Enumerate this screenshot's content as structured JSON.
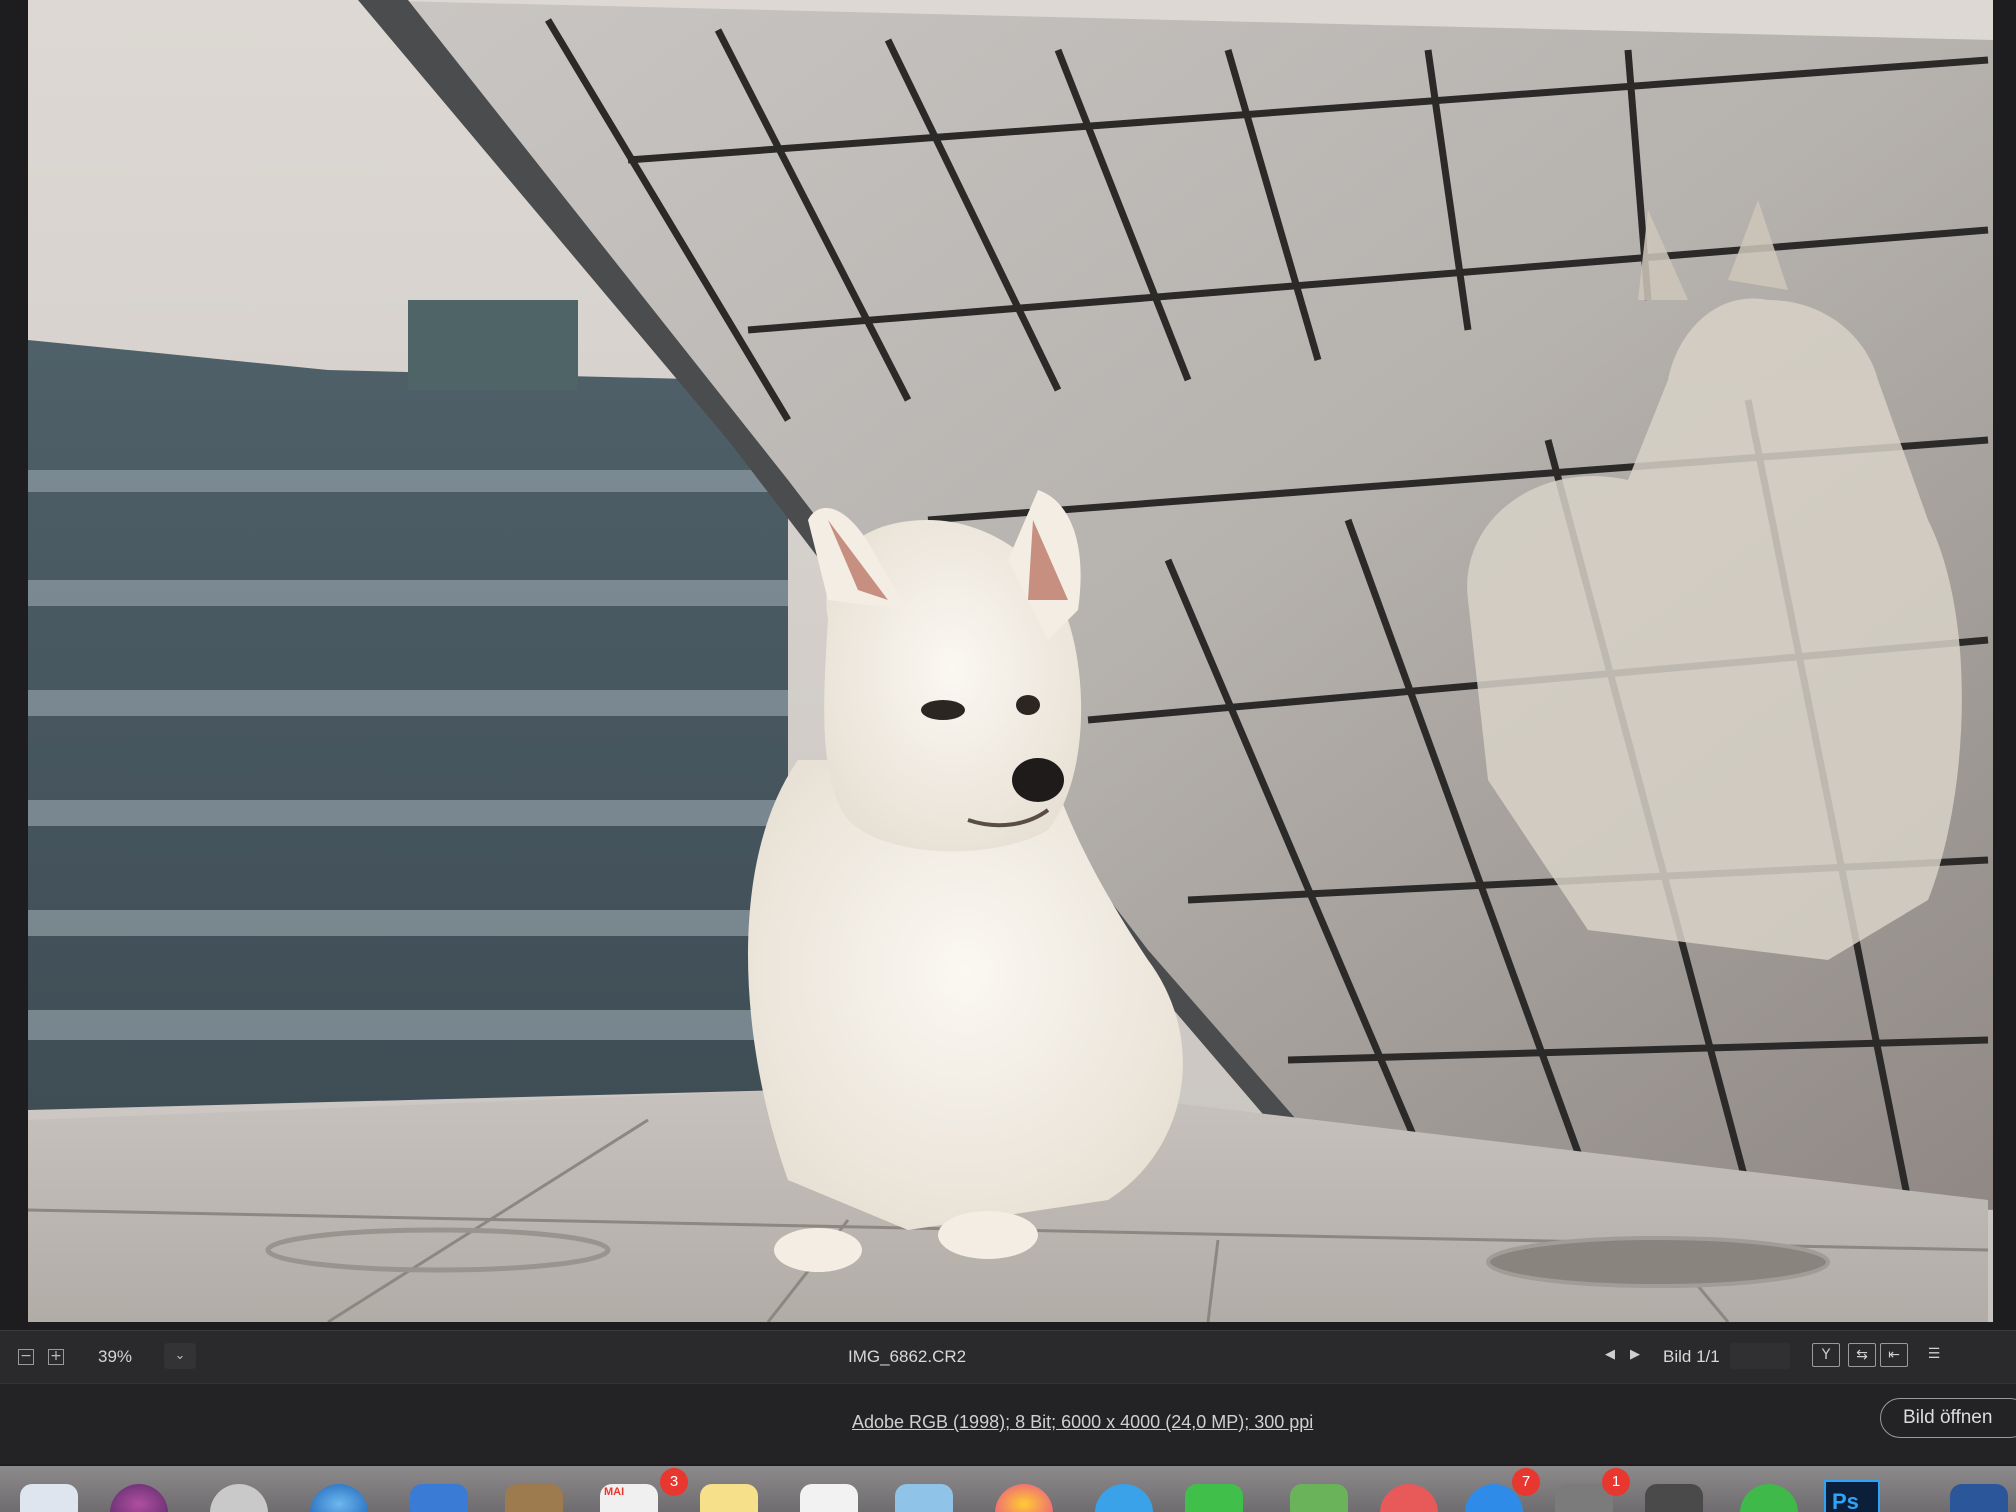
{
  "viewer": {
    "zoom_level": "39%",
    "zoom_out_symbol": "−",
    "zoom_in_symbol": "+",
    "zoom_dropdown_symbol": "⌄",
    "filename": "IMG_6862.CR2",
    "prev_symbol": "◀",
    "next_symbol": "▶",
    "pager": "Bild 1/1",
    "tools": [
      {
        "icon": "filter-icon",
        "symbol": "Y"
      },
      {
        "icon": "compare-icon",
        "symbol": "⇆"
      },
      {
        "icon": "rotate-icon",
        "symbol": "⇤"
      },
      {
        "icon": "settings-sliders-icon",
        "symbol": "☰"
      }
    ]
  },
  "info": {
    "metadata": "Adobe RGB (1998); 8 Bit; 6000 x 4000 (24,0 MP); 300 ppi",
    "open_button": "Bild öffnen"
  },
  "dock": {
    "badges": {
      "calendar": "3",
      "mail": "7",
      "appstore": "1"
    },
    "calendar_month": "MAI",
    "photoshop_label": "Ps"
  },
  "colors": {
    "ui_bar": "#2a2a2c",
    "photoshop_blue": "#2fa3f7",
    "badge_red": "#e8372f"
  }
}
